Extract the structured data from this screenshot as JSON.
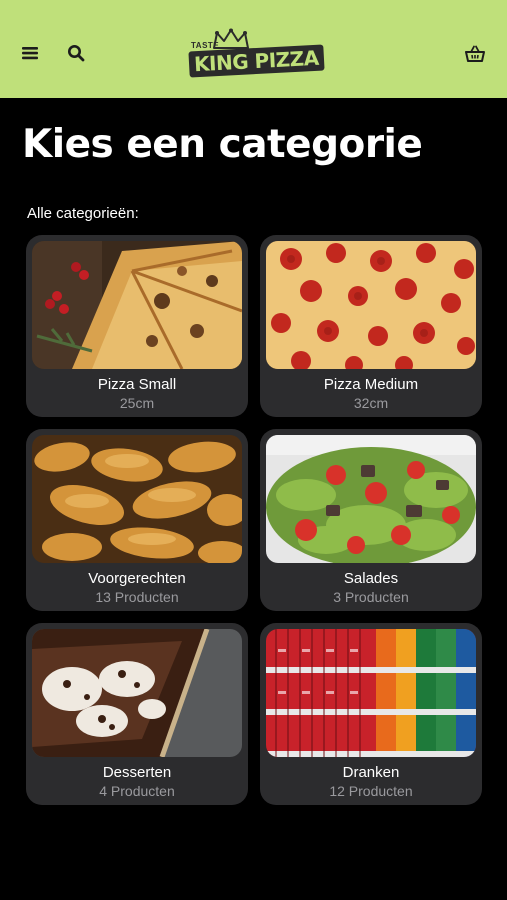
{
  "header": {
    "logo_small": "TASTE",
    "logo_text": "KING PIZZA",
    "icons": [
      "hamburger-menu-icon",
      "search-icon",
      "basket-icon"
    ],
    "bg_color": "#bfe07a"
  },
  "main": {
    "title": "Kies een categorie",
    "section_label": "Alle categorieën:",
    "categories": [
      {
        "name": "Pizza Small",
        "subtitle": "25cm",
        "image": "pizza-slices"
      },
      {
        "name": "Pizza Medium",
        "subtitle": "32cm",
        "image": "pepperoni-pizza"
      },
      {
        "name": "Voorgerechten",
        "subtitle": "13 Producten",
        "image": "roasted-potatoes"
      },
      {
        "name": "Salades",
        "subtitle": "3 Producten",
        "image": "salad"
      },
      {
        "name": "Desserten",
        "subtitle": "4 Producten",
        "image": "tiramisu"
      },
      {
        "name": "Dranken",
        "subtitle": "12 Producten",
        "image": "drink-shelves"
      }
    ]
  }
}
